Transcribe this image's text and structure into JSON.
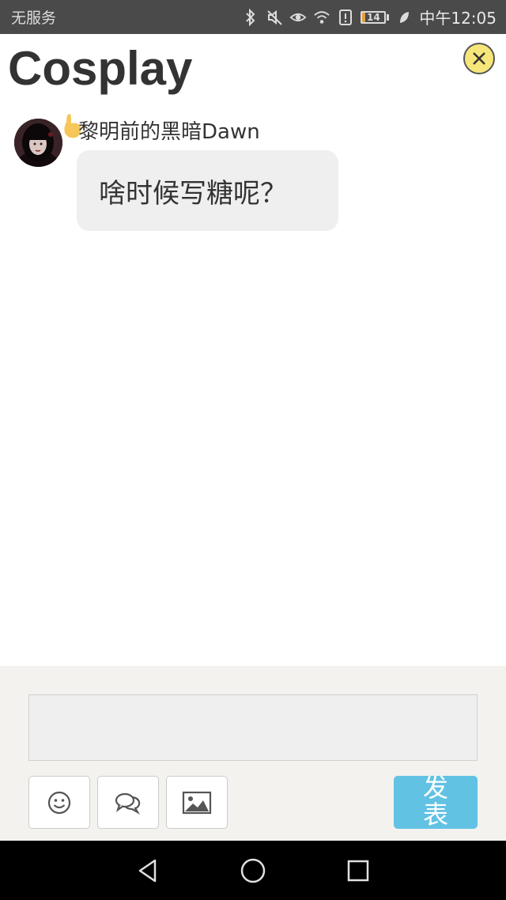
{
  "status_bar": {
    "carrier": "无服务",
    "battery_level": "14",
    "time": "中午12:05",
    "icons": [
      "bluetooth-icon",
      "mute-icon",
      "eye-icon",
      "wifi-icon",
      "alert-icon",
      "battery-icon",
      "leaf-icon"
    ]
  },
  "header": {
    "title": "Cosplay",
    "close_icon": "close-icon"
  },
  "messages": [
    {
      "sender": "黎明前的黑暗Dawn",
      "text": "啥时候写糖呢？"
    }
  ],
  "composer": {
    "input_value": "",
    "tools": [
      "emoji-icon",
      "comment-icon",
      "image-icon"
    ],
    "send_label": "发表"
  },
  "nav": {
    "icons": [
      "back-icon",
      "home-icon",
      "recents-icon"
    ]
  },
  "colors": {
    "status_bar": "#4a4a4a",
    "bubble": "#efefef",
    "composer_bg": "#f3f2ee",
    "send_button": "#62c2e4",
    "close_button": "#f6e67a"
  }
}
